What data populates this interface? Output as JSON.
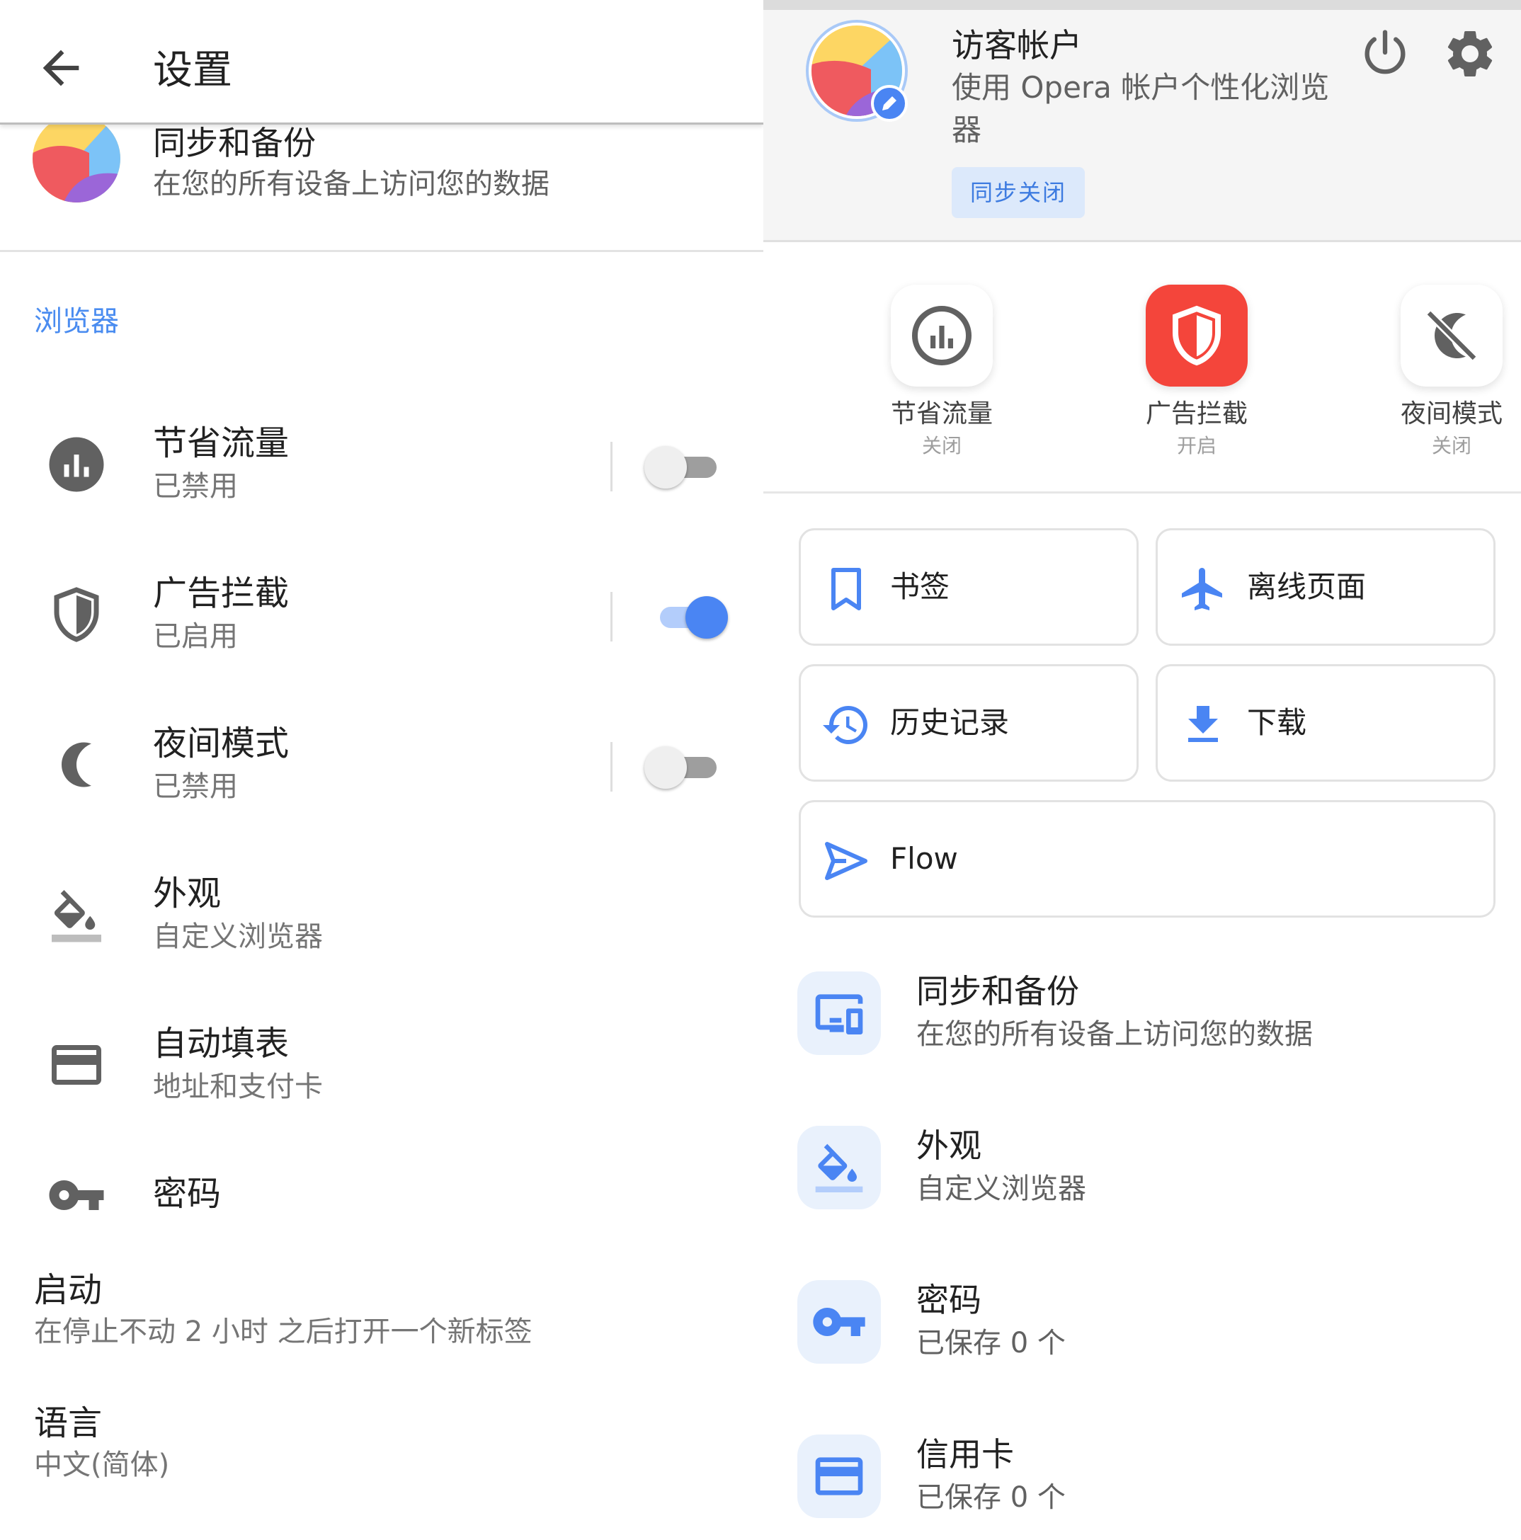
{
  "left": {
    "title": "设置",
    "sync": {
      "title": "同步和备份",
      "subtitle": "在您的所有设备上访问您的数据"
    },
    "section_browser": "浏览器",
    "rows": [
      {
        "title": "节省流量",
        "subtitle": "已禁用",
        "toggle": "off"
      },
      {
        "title": "广告拦截",
        "subtitle": "已启用",
        "toggle": "on"
      },
      {
        "title": "夜间模式",
        "subtitle": "已禁用",
        "toggle": "off"
      },
      {
        "title": "外观",
        "subtitle": "自定义浏览器"
      },
      {
        "title": "自动填表",
        "subtitle": "地址和支付卡"
      },
      {
        "title": "密码",
        "subtitle": ""
      }
    ],
    "startup": {
      "title": "启动",
      "subtitle": "在停止不动 2 小时 之后打开一个新标签"
    },
    "language": {
      "title": "语言",
      "subtitle": "中文(简体)"
    }
  },
  "right": {
    "account": {
      "name": "访客帐户",
      "desc": "使用 Opera 帐户个性化浏览器",
      "sync_badge": "同步关闭"
    },
    "quick": [
      {
        "label": "节省流量",
        "status": "关闭",
        "icon": "data-savings-icon"
      },
      {
        "label": "广告拦截",
        "status": "开启",
        "icon": "shield-icon"
      },
      {
        "label": "夜间模式",
        "status": "关闭",
        "icon": "night-mode-off-icon"
      }
    ],
    "cards": {
      "bookmarks": "书签",
      "offline": "离线页面",
      "history": "历史记录",
      "downloads": "下载",
      "flow": "Flow"
    },
    "list": [
      {
        "title": "同步和备份",
        "subtitle": "在您的所有设备上访问您的数据"
      },
      {
        "title": "外观",
        "subtitle": "自定义浏览器"
      },
      {
        "title": "密码",
        "subtitle": "已保存 0 个"
      },
      {
        "title": "信用卡",
        "subtitle": "已保存 0 个"
      }
    ]
  },
  "colors": {
    "accent": "#4a85f3",
    "adblock_red": "#f4453b",
    "section_blue": "#4a8cf0"
  }
}
